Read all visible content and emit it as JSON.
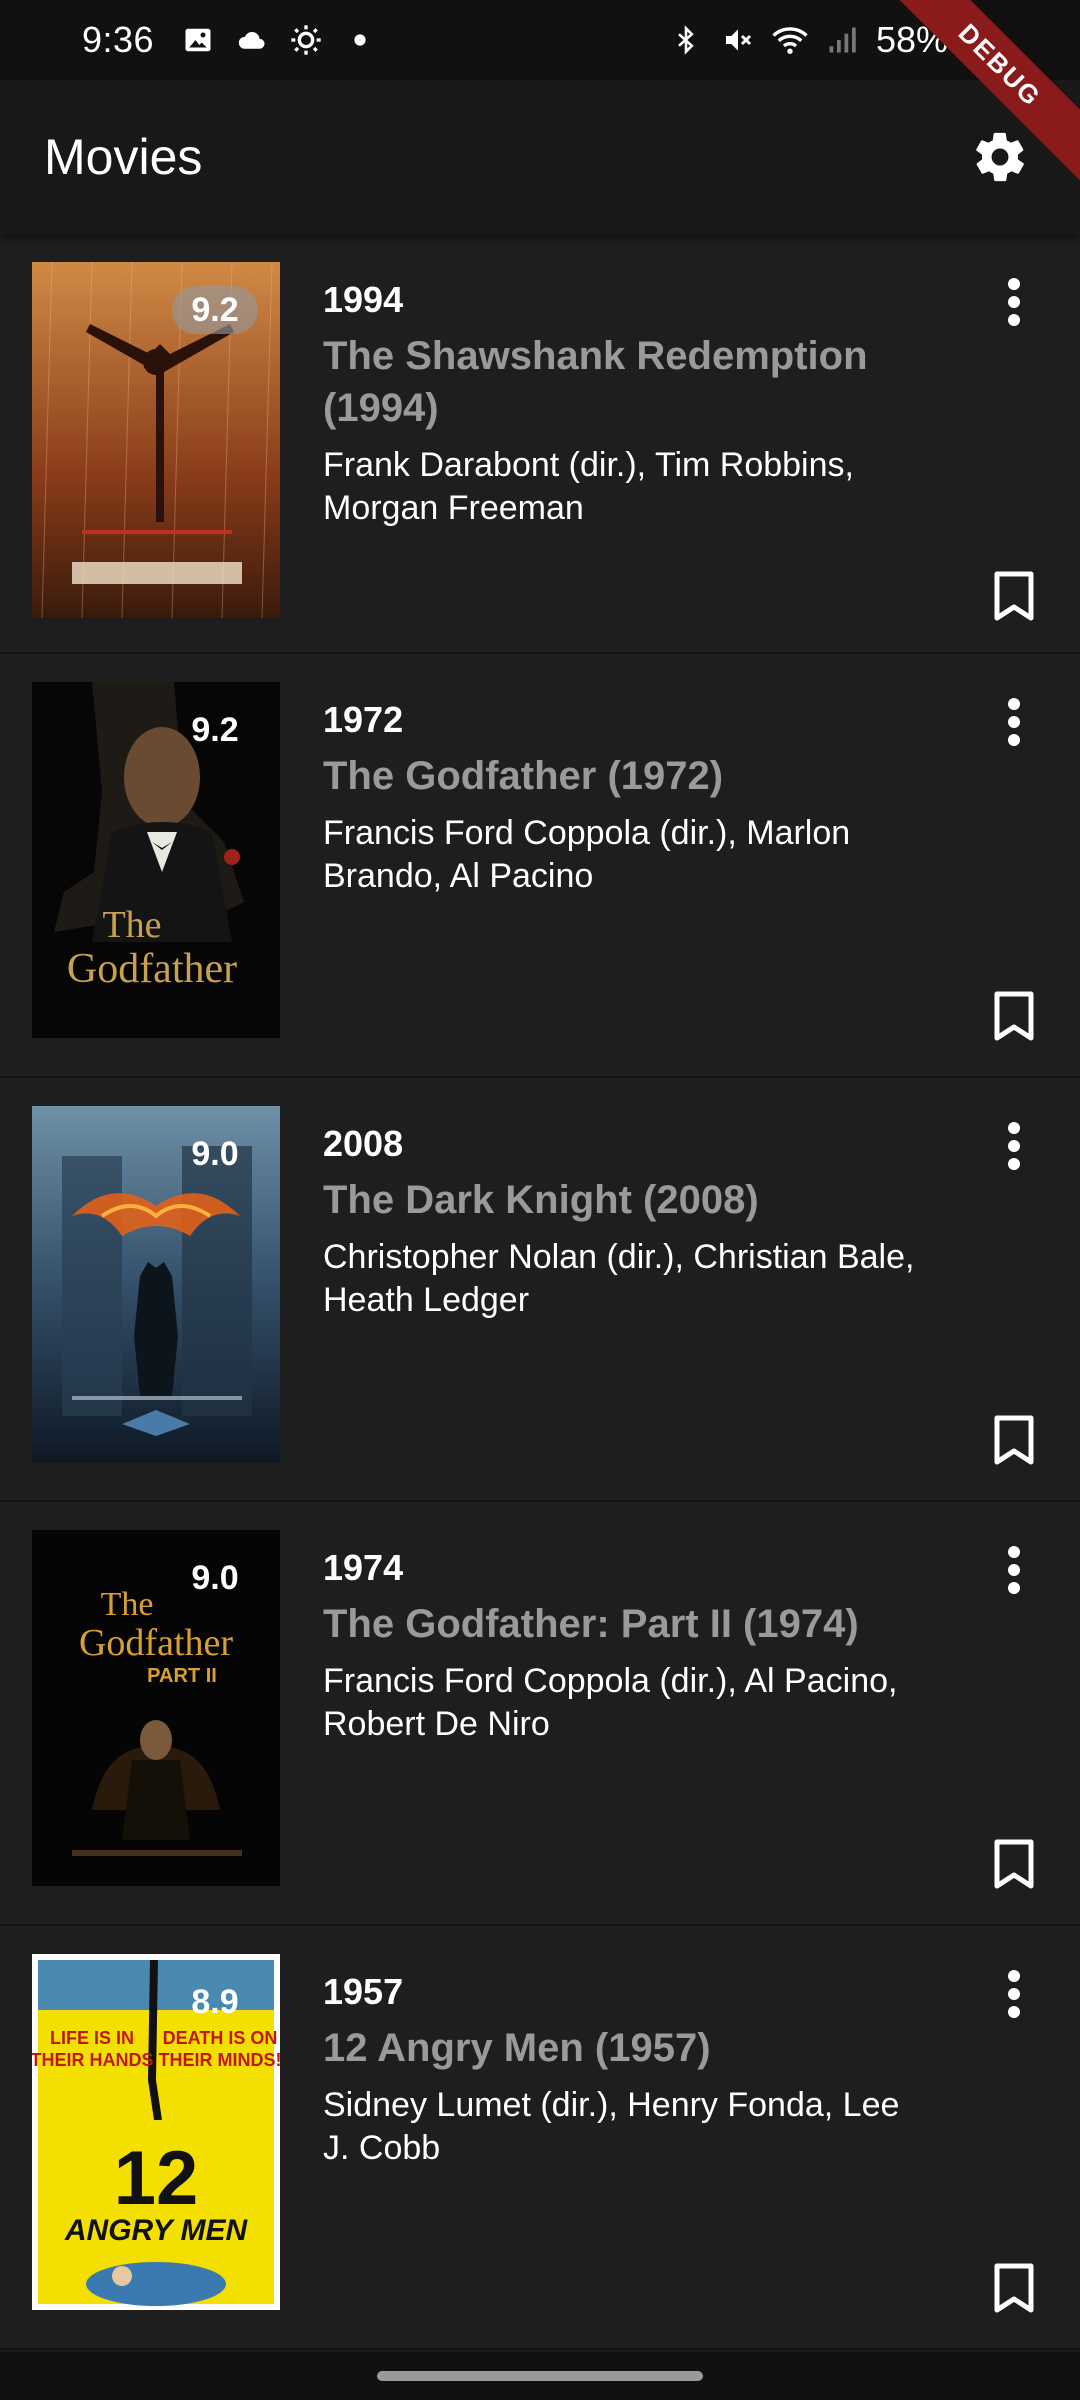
{
  "status_bar": {
    "time": "9:36",
    "battery": "58%",
    "icons_left": [
      "gallery-icon",
      "cloud-icon",
      "brightness-icon",
      "dot-icon"
    ],
    "icons_right": [
      "bluetooth-icon",
      "mute-icon",
      "wifi-icon",
      "signal-icon",
      "battery-icon"
    ]
  },
  "debug_banner": "DEBUG",
  "app_bar": {
    "title": "Movies",
    "settings_icon": "gear-icon"
  },
  "movies": [
    {
      "year": "1994",
      "title": "The Shawshank Redemption (1994)",
      "credits": "Frank Darabont (dir.), Tim Robbins, Morgan Freeman",
      "rating": "9.2",
      "poster_colors": [
        "#c87a3c",
        "#6a3018"
      ]
    },
    {
      "year": "1972",
      "title": "The Godfather (1972)",
      "credits": "Francis Ford Coppola (dir.), Marlon Brando, Al Pacino",
      "rating": "9.2",
      "poster_colors": [
        "#000000",
        "#2a2a2a"
      ]
    },
    {
      "year": "2008",
      "title": "The Dark Knight (2008)",
      "credits": "Christopher Nolan (dir.), Christian Bale, Heath Ledger",
      "rating": "9.0",
      "poster_colors": [
        "#5b7c92",
        "#1c2a38"
      ]
    },
    {
      "year": "1974",
      "title": "The Godfather: Part II (1974)",
      "credits": "Francis Ford Coppola (dir.), Al Pacino, Robert De Niro",
      "rating": "9.0",
      "poster_colors": [
        "#000000",
        "#241608"
      ]
    },
    {
      "year": "1957",
      "title": "12 Angry Men (1957)",
      "credits": "Sidney Lumet (dir.), Henry Fonda, Lee J. Cobb",
      "rating": "8.9",
      "poster_colors": [
        "#f5e000",
        "#ffffff"
      ]
    }
  ],
  "item_actions": {
    "more_icon": "more-vert-icon",
    "bookmark_icon": "bookmark-icon"
  }
}
